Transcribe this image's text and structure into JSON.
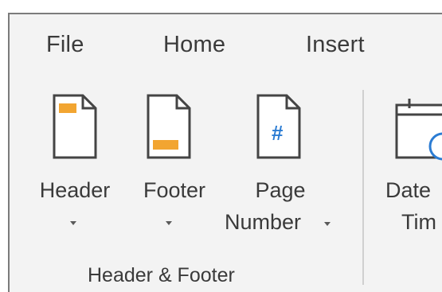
{
  "tabs": [
    {
      "label": "File"
    },
    {
      "label": "Home"
    },
    {
      "label": "Insert"
    }
  ],
  "group": {
    "label": "Header & Footer",
    "buttons": {
      "header": {
        "label": "Header",
        "icon": "header-page-icon"
      },
      "footer": {
        "label": "Footer",
        "icon": "footer-page-icon"
      },
      "page_number": {
        "line1": "Page",
        "line2": "Number",
        "icon": "page-number-icon",
        "symbol": "#"
      }
    }
  },
  "next_group": {
    "date_time": {
      "line1": "Date",
      "line2": "Tim",
      "icon": "calendar-clock-icon"
    }
  },
  "colors": {
    "accent_orange": "#f2a531",
    "accent_blue": "#2b7cd3",
    "ribbon_bg": "#f3f3f3"
  }
}
